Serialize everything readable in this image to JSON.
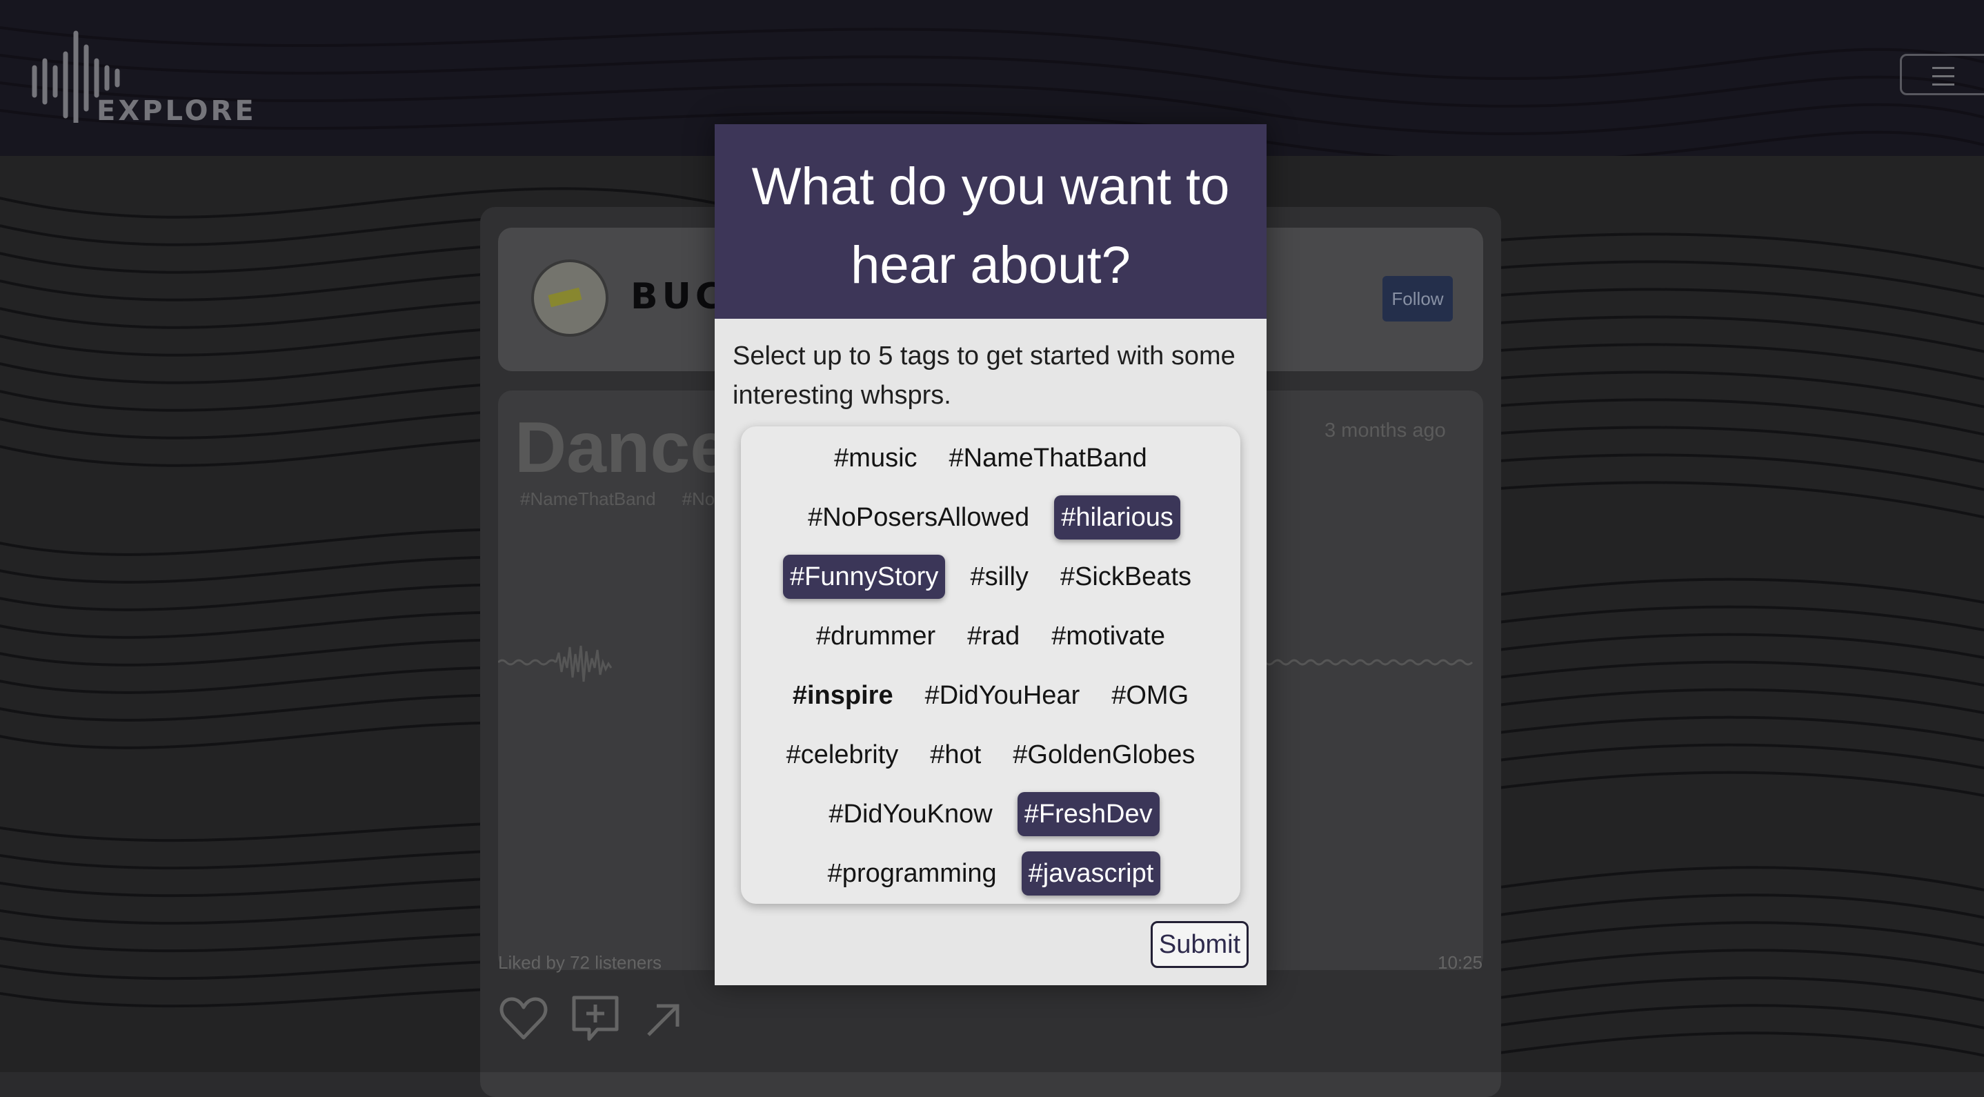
{
  "app": {
    "logo_word": "EXPLORE",
    "logo_mark": "WHSPR"
  },
  "profile": {
    "username": "BUCK",
    "follow_label": "Follow"
  },
  "post": {
    "title": "Dance",
    "tags": [
      "#NameThatBand",
      "#No"
    ],
    "time_ago": "3 months ago",
    "liked_by": "Liked by 72 listeners",
    "duration": "10:25"
  },
  "modal": {
    "title": "What do you want to hear about?",
    "description": "Select up to 5 tags to get started with some interesting whsprs.",
    "tag_rows": [
      [
        {
          "label": "#music",
          "selected": false
        },
        {
          "label": "#NameThatBand",
          "selected": false
        }
      ],
      [
        {
          "label": "#NoPosersAllowed",
          "selected": false
        },
        {
          "label": "#hilarious",
          "selected": true
        }
      ],
      [
        {
          "label": "#FunnyStory",
          "selected": true
        },
        {
          "label": "#silly",
          "selected": false
        },
        {
          "label": "#SickBeats",
          "selected": false
        }
      ],
      [
        {
          "label": "#drummer",
          "selected": false
        },
        {
          "label": "#rad",
          "selected": false
        },
        {
          "label": "#motivate",
          "selected": false
        }
      ],
      [
        {
          "label": "#inspire",
          "selected": false,
          "bold": true
        },
        {
          "label": "#DidYouHear",
          "selected": false
        },
        {
          "label": "#OMG",
          "selected": false
        }
      ],
      [
        {
          "label": "#celebrity",
          "selected": false
        },
        {
          "label": "#hot",
          "selected": false
        },
        {
          "label": "#GoldenGlobes",
          "selected": false
        }
      ],
      [
        {
          "label": "#DidYouKnow",
          "selected": false
        },
        {
          "label": "#FreshDev",
          "selected": true
        }
      ],
      [
        {
          "label": "#programming",
          "selected": false
        },
        {
          "label": "#javascript",
          "selected": true
        }
      ]
    ],
    "submit_label": "Submit"
  },
  "colors": {
    "accent": "#3d3658",
    "topbar": "#1d1b26",
    "follow_bg": "#2c3a5c"
  },
  "icons": [
    "menu-icon",
    "heart-icon",
    "add-comment-icon",
    "share-arrow-icon"
  ]
}
